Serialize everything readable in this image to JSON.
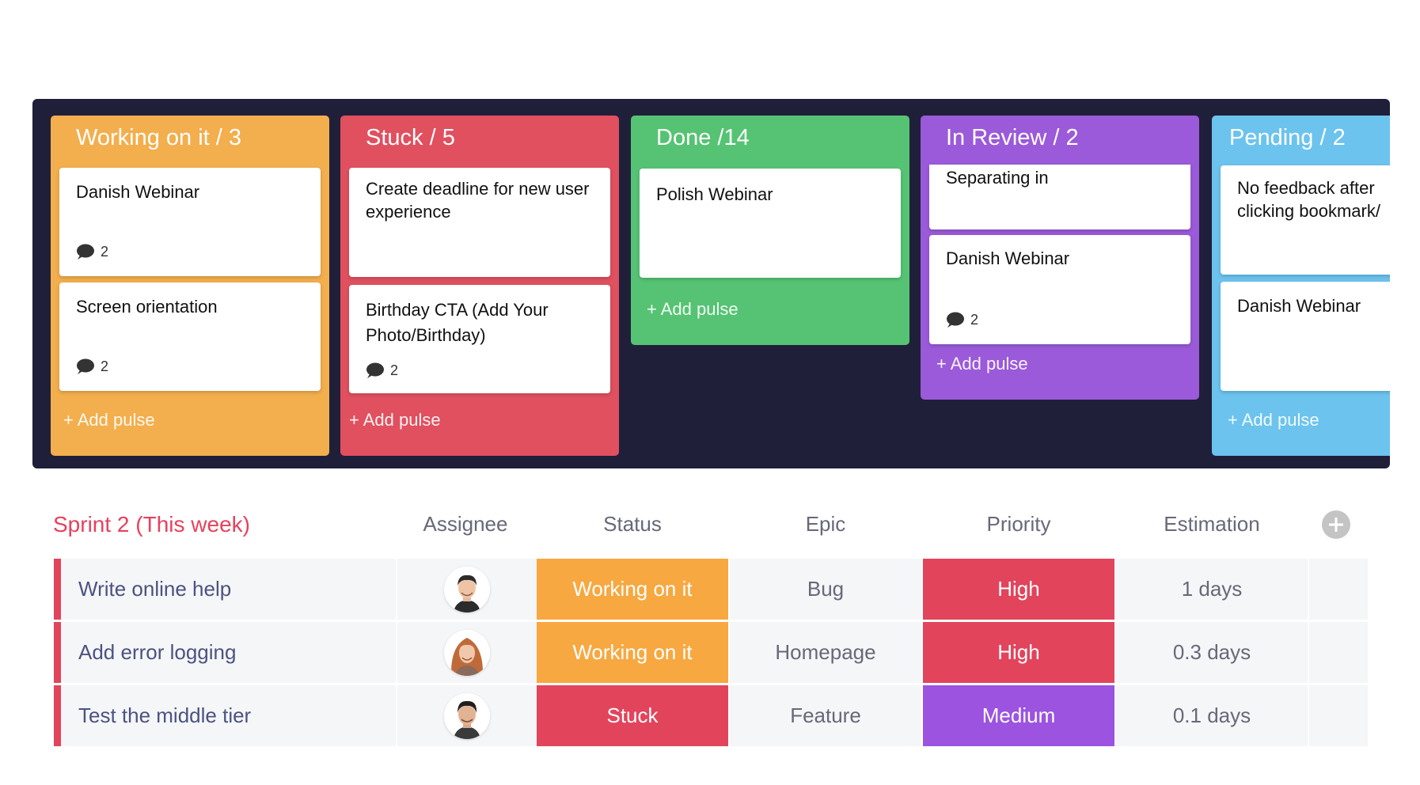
{
  "colors": {
    "board_bg": "#1f1f3a",
    "working": "#f3ae4d",
    "stuck": "#e0505f",
    "done": "#55c373",
    "review": "#9b5ad9",
    "pending": "#6cc3ee",
    "group": "#e8405d",
    "status_working": "#f7a841",
    "status_stuck": "#e2445c",
    "priority_high": "#e2445c",
    "priority_medium": "#9b53e0"
  },
  "board": {
    "columns": [
      {
        "title": "Working on it / 3",
        "add_label": "+ Add pulse",
        "cards": [
          {
            "text": "Danish Webinar",
            "comments": "2"
          },
          {
            "text": "Screen orientation",
            "comments": "2"
          }
        ]
      },
      {
        "title": "Stuck / 5",
        "add_label": "+ Add pulse",
        "cards": [
          {
            "text": "Create deadline for new user experience"
          },
          {
            "text": "Birthday CTA (Add Your Photo/Birthday)",
            "comments": "2"
          }
        ]
      },
      {
        "title": "Done /14",
        "add_label": "+ Add pulse",
        "cards": [
          {
            "text": "Polish Webinar"
          }
        ]
      },
      {
        "title": "In Review / 2",
        "add_label": "+ Add pulse",
        "cards": [
          {
            "text": "Separating in"
          },
          {
            "text": "Danish Webinar",
            "comments": "2"
          }
        ]
      },
      {
        "title": "Pending / 2",
        "add_label": "+ Add pulse",
        "cards": [
          {
            "text": "No feedback after clicking bookmark/"
          },
          {
            "text": "Danish Webinar"
          }
        ]
      }
    ]
  },
  "table": {
    "group_title": "Sprint 2 (This week)",
    "headers": {
      "assignee": "Assignee",
      "status": "Status",
      "epic": "Epic",
      "priority": "Priority",
      "estimation": "Estimation"
    },
    "rows": [
      {
        "name": "Write online help",
        "assignee": "man-short-hair",
        "status": "Working on it",
        "epic": "Bug",
        "priority": "High",
        "estimation": "1 days"
      },
      {
        "name": "Add error logging",
        "assignee": "woman-red-hair",
        "status": "Working on it",
        "epic": "Homepage",
        "priority": "High",
        "estimation": "0.3 days"
      },
      {
        "name": "Test the middle tier",
        "assignee": "man-dark-hair",
        "status": "Stuck",
        "epic": "Feature",
        "priority": "Medium",
        "estimation": "0.1 days"
      }
    ]
  }
}
